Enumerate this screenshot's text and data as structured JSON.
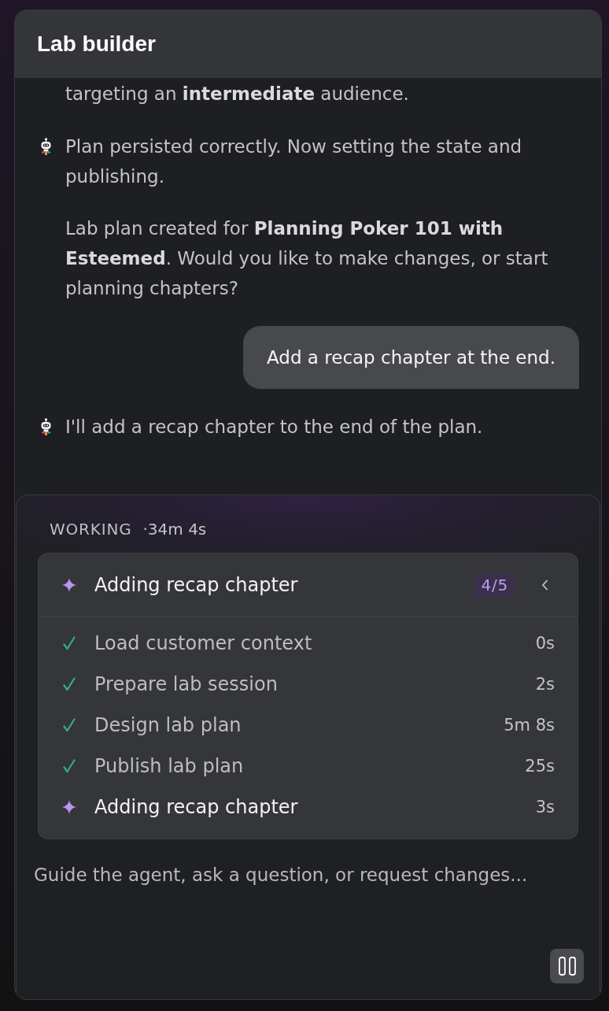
{
  "header": {
    "title": "Lab builder"
  },
  "messages": [
    {
      "kind": "agent_text",
      "paragraphs": [
        "targeting an **intermediate** audience."
      ]
    },
    {
      "kind": "agent",
      "paragraphs": [
        "Plan persisted correctly. Now setting the state and publishing.",
        "Lab plan created for **Planning Poker 101 with Esteemed**. Would you like to make changes, or start planning chapters?"
      ]
    },
    {
      "kind": "user",
      "text": "Add a recap chapter at the end."
    },
    {
      "kind": "agent",
      "paragraphs": [
        "I'll add a recap chapter to the end of the plan."
      ]
    }
  ],
  "working": {
    "label": "WORKING",
    "elapsed": "·34m 4s"
  },
  "task": {
    "title": "Adding recap chapter",
    "progress": "4/5",
    "expanded": true,
    "steps": [
      {
        "kind": "done",
        "label": "Load customer context",
        "time": "0s"
      },
      {
        "kind": "done",
        "label": "Prepare lab session",
        "time": "2s"
      },
      {
        "kind": "done",
        "label": "Design lab plan",
        "time": "5m 8s"
      },
      {
        "kind": "done",
        "label": "Publish lab plan",
        "time": "25s"
      },
      {
        "kind": "active",
        "label": "Adding recap chapter",
        "time": "3s"
      }
    ]
  },
  "composer": {
    "placeholder": "Guide the agent, ask a question, or request changes..."
  }
}
